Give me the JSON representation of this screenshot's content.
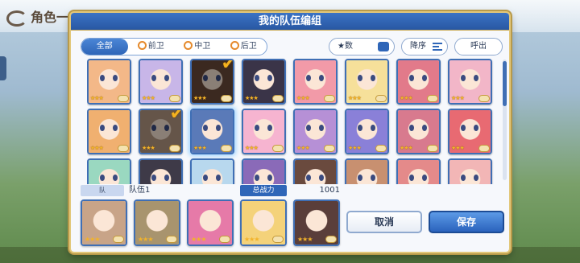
{
  "background": {
    "title": "角色一览"
  },
  "dialog": {
    "title": "我的队伍编组"
  },
  "toolbar": {
    "filters": [
      {
        "label": "全部",
        "active": true
      },
      {
        "label": "前卫",
        "active": false
      },
      {
        "label": "中卫",
        "active": false
      },
      {
        "label": "后卫",
        "active": false
      }
    ],
    "star_sort_label": "★数",
    "order_label": "降序",
    "call_label": "呼出"
  },
  "grid": {
    "rows": [
      [
        {
          "color": "#f3b888",
          "stars": "★★★",
          "checked": false,
          "dimmed": false
        },
        {
          "color": "#c8b6e8",
          "stars": "★★★",
          "checked": false,
          "dimmed": false
        },
        {
          "color": "#6b4a3a",
          "stars": "★★★",
          "checked": true,
          "dimmed": true
        },
        {
          "color": "#3a3448",
          "stars": "★★★",
          "checked": false,
          "dimmed": false
        },
        {
          "color": "#f29aa8",
          "stars": "★★★",
          "checked": false,
          "dimmed": false
        },
        {
          "color": "#f6e09a",
          "stars": "★★★",
          "checked": false,
          "dimmed": false
        },
        {
          "color": "#e27a8a",
          "stars": "★★★",
          "checked": false,
          "dimmed": false
        },
        {
          "color": "#f2b6c8",
          "stars": "★★★",
          "checked": false,
          "dimmed": false
        }
      ],
      [
        {
          "color": "#f0b070",
          "stars": "★★★",
          "checked": false,
          "dimmed": false
        },
        {
          "color": "#b89a84",
          "stars": "★★★",
          "checked": true,
          "dimmed": true
        },
        {
          "color": "#5a7ab8",
          "stars": "★★★",
          "checked": false,
          "dimmed": false,
          "glow": true
        },
        {
          "color": "#f6b4d0",
          "stars": "★★★",
          "checked": false,
          "dimmed": false
        },
        {
          "color": "#b690d6",
          "stars": "★★★",
          "checked": false,
          "dimmed": false
        },
        {
          "color": "#8a80d8",
          "stars": "★★★",
          "checked": false,
          "dimmed": false
        },
        {
          "color": "#d87a8e",
          "stars": "★★★",
          "checked": false,
          "dimmed": false
        },
        {
          "color": "#e86a72",
          "stars": "★★★",
          "checked": false,
          "dimmed": false
        }
      ],
      [
        {
          "color": "#9ad8c0",
          "stars": "",
          "checked": false,
          "dimmed": false
        },
        {
          "color": "#3e3a48",
          "stars": "",
          "checked": false,
          "dimmed": false
        },
        {
          "color": "#b8d8ee",
          "stars": "",
          "checked": false,
          "dimmed": false
        },
        {
          "color": "#8a6ab8",
          "stars": "",
          "checked": false,
          "dimmed": false
        },
        {
          "color": "#6a4a3e",
          "stars": "",
          "checked": false,
          "dimmed": false
        },
        {
          "color": "#c89070",
          "stars": "",
          "checked": false,
          "dimmed": false
        },
        {
          "color": "#e48a8a",
          "stars": "",
          "checked": false,
          "dimmed": false
        },
        {
          "color": "#f2b6b6",
          "stars": "",
          "checked": false,
          "dimmed": false
        }
      ]
    ]
  },
  "team": {
    "tag": "队",
    "name": "队伍1",
    "power_label": "总战力",
    "power_value": "1001",
    "slots": [
      {
        "color": "#c8a488",
        "stars": "★★★"
      },
      {
        "color": "#a8946e",
        "stars": "★★★"
      },
      {
        "color": "#e67aa8",
        "stars": "★★★"
      },
      {
        "color": "#f4d27a",
        "stars": "★★★"
      },
      {
        "color": "#5a3e3a",
        "stars": "★★★"
      }
    ]
  },
  "actions": {
    "cancel_label": "取消",
    "save_label": "保存"
  },
  "colors": {
    "accent": "#2f66b8",
    "header": "#2857a3",
    "frame_gold": "#e2c77a",
    "star": "#f2b32a",
    "check": "#f5b21f"
  }
}
